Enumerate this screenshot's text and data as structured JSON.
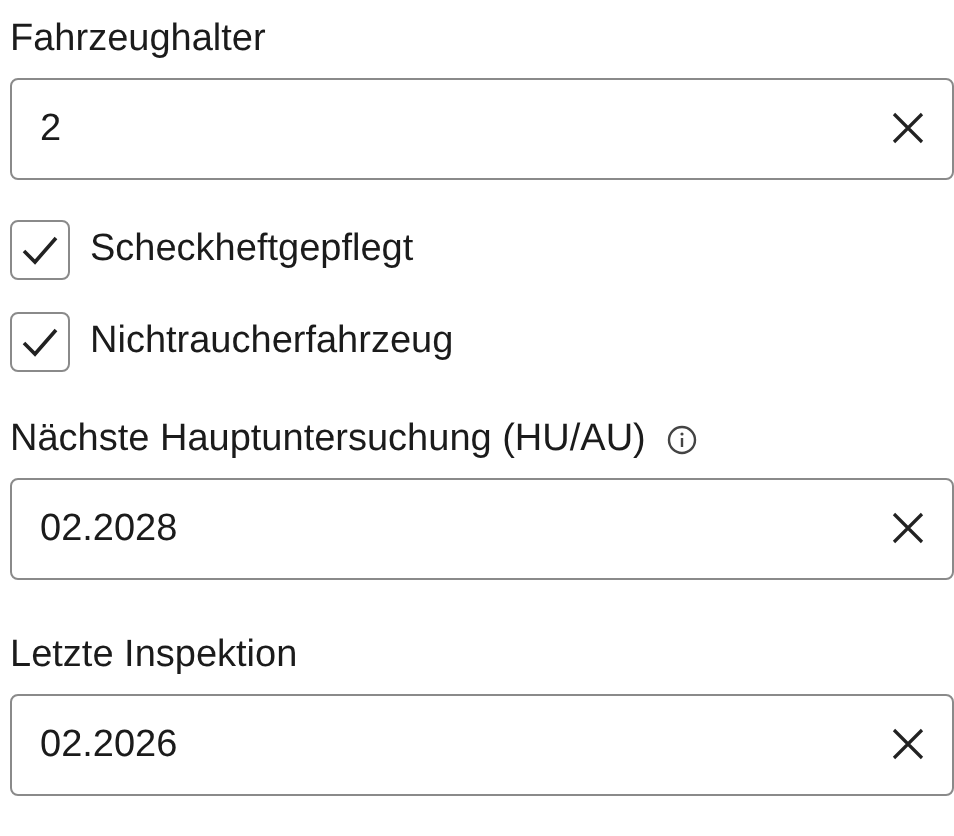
{
  "fields": [
    {
      "kind": "text",
      "label": "Fahrzeughalter",
      "value": "2"
    },
    {
      "kind": "checkbox",
      "label": "Scheckheftgepflegt",
      "checked": true
    },
    {
      "kind": "checkbox",
      "label": "Nichtraucherfahrzeug",
      "checked": true
    },
    {
      "kind": "text",
      "label": "Nächste Hauptuntersuchung (HU/AU)",
      "info": true,
      "value": "02.2028"
    },
    {
      "kind": "text",
      "label": "Letzte Inspektion",
      "value": "02.2026"
    }
  ]
}
